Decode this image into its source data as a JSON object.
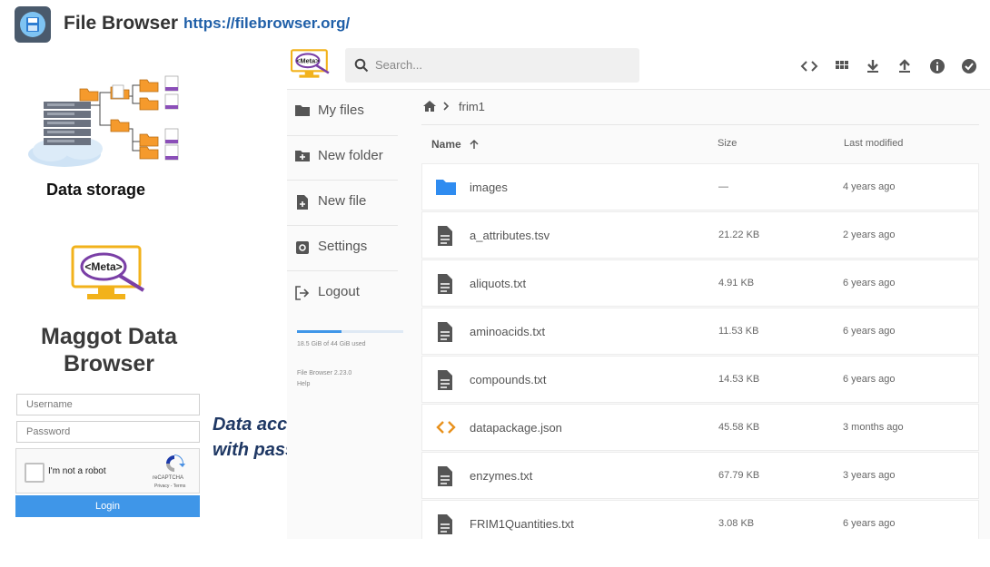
{
  "header": {
    "title": "File Browser",
    "url": "https://filebrowser.org/"
  },
  "left": {
    "data_storage_caption": "Data storage",
    "meta_logo_text": "<Meta>",
    "maggot_title_line1": "Maggot Data",
    "maggot_title_line2": "Browser",
    "username_placeholder": "Username",
    "password_placeholder": "Password",
    "captcha_label": "I'm not a robot",
    "captcha_brand": "reCAPTCHA",
    "captcha_terms": "Privacy - Terms",
    "login_label": "Login",
    "note_line1": "Data accessible",
    "note_line2": "with password"
  },
  "browser": {
    "search_placeholder": "Search...",
    "toolbar_icons": [
      "code-icon",
      "grid-view-icon",
      "download-icon",
      "upload-icon",
      "info-icon",
      "check-circle-icon"
    ],
    "sidebar": [
      {
        "label": "My files",
        "icon": "folder-icon"
      },
      {
        "label": "New folder",
        "icon": "add-folder-icon"
      },
      {
        "label": "New file",
        "icon": "add-file-icon"
      },
      {
        "label": "Settings",
        "icon": "settings-icon"
      },
      {
        "label": "Logout",
        "icon": "logout-icon"
      }
    ],
    "usage_fraction": 0.42,
    "usage_text": "18.5 GiB of 44 GiB used",
    "version_text": "File Browser 2.23.0",
    "help_text": "Help",
    "breadcrumb": "frim1",
    "columns": {
      "name": "Name",
      "size": "Size",
      "modified": "Last modified"
    },
    "files": [
      {
        "name": "images",
        "size": "—",
        "modified": "4 years ago",
        "type": "folder"
      },
      {
        "name": "a_attributes.tsv",
        "size": "21.22 KB",
        "modified": "2 years ago",
        "type": "file"
      },
      {
        "name": "aliquots.txt",
        "size": "4.91 KB",
        "modified": "6 years ago",
        "type": "file"
      },
      {
        "name": "aminoacids.txt",
        "size": "11.53 KB",
        "modified": "6 years ago",
        "type": "file"
      },
      {
        "name": "compounds.txt",
        "size": "14.53 KB",
        "modified": "6 years ago",
        "type": "file"
      },
      {
        "name": "datapackage.json",
        "size": "45.58 KB",
        "modified": "3 months ago",
        "type": "code"
      },
      {
        "name": "enzymes.txt",
        "size": "67.79 KB",
        "modified": "3 years ago",
        "type": "file"
      },
      {
        "name": "FRIM1Quantities.txt",
        "size": "3.08 KB",
        "modified": "6 years ago",
        "type": "file"
      }
    ]
  },
  "colors": {
    "accent": "#3f96e8",
    "note": "#1f3864",
    "folder": "#2f8cf0",
    "code": "#e8911c"
  }
}
